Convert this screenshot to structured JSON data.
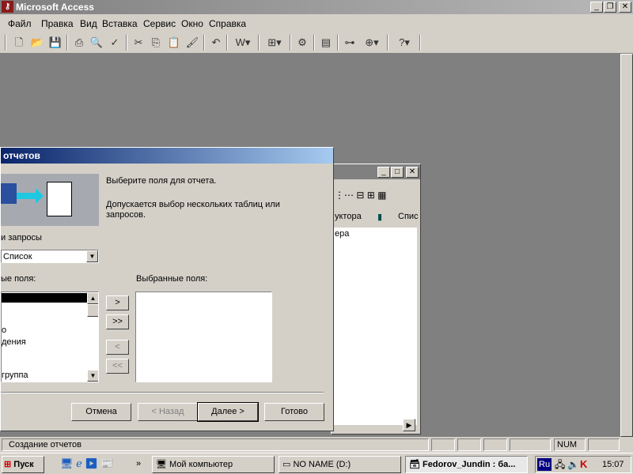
{
  "app": {
    "title": "Microsoft Access"
  },
  "menu": [
    "Файл",
    "Правка",
    "Вид",
    "Вставка",
    "Сервис",
    "Окно",
    "Справка"
  ],
  "db_window": {
    "col_left": "уктора",
    "col_right": "Спис",
    "item": "ера"
  },
  "wizard": {
    "title": "отчетов",
    "heading": "Выберите поля для отчета.",
    "hint": "Допускается выбор нескольких таблиц или запросов.",
    "source_label": "и запросы",
    "source_value": "Список",
    "available_label": "ые поля:",
    "available_items": [
      "",
      "",
      "",
      "о",
      "дения",
      "",
      "",
      "группа"
    ],
    "selected_label": "Выбранные поля:",
    "move_one": ">",
    "move_all": ">>",
    "remove_one": "<",
    "remove_all": "<<",
    "cancel": "Отмена",
    "back": "< Назад",
    "next": "Далее >",
    "finish": "Готово"
  },
  "status": {
    "text": "Создание отчетов",
    "num": "NUM"
  },
  "taskbar": {
    "start": "Пуск",
    "tasks": [
      "Мой компьютер",
      "NO NAME (D:)",
      "Fedorov_Jundin : ба..."
    ],
    "lang": "Ru",
    "clock": "15:07",
    "more": "»"
  }
}
